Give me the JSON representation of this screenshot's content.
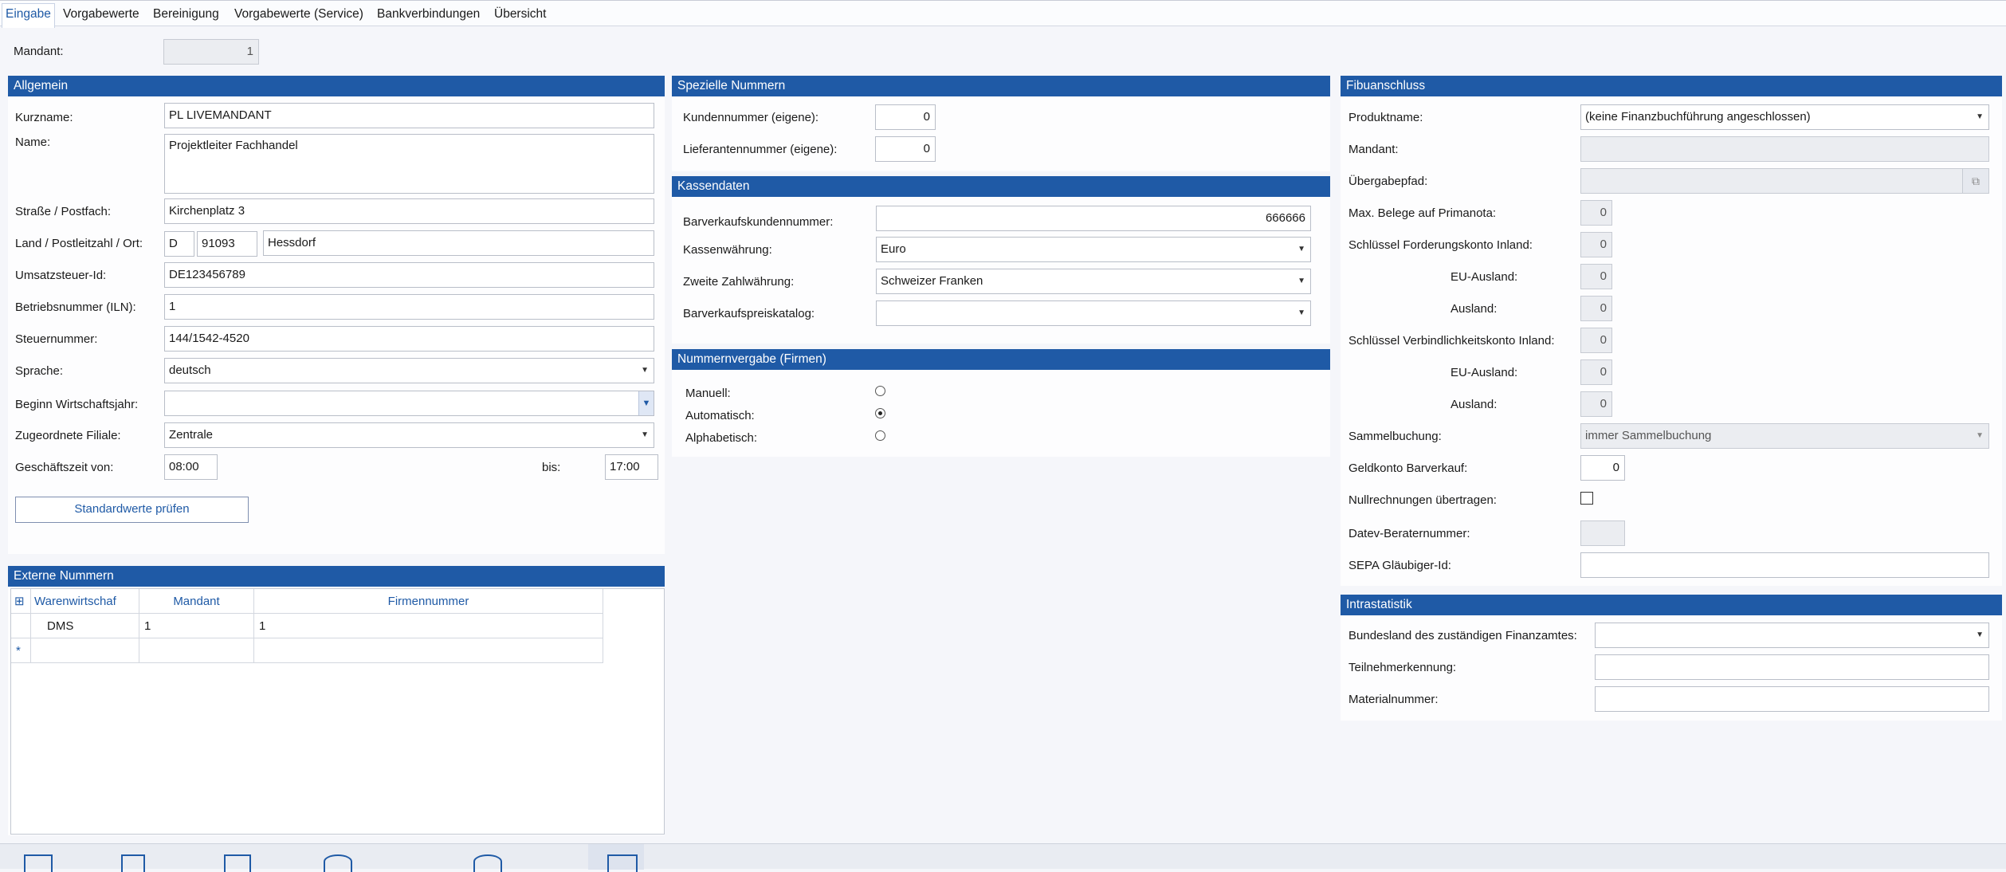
{
  "tabs": [
    "Eingabe",
    "Vorgabewerte",
    "Bereinigung",
    "Vorgabewerte (Service)",
    "Bankverbindungen",
    "Übersicht"
  ],
  "mandant": {
    "label": "Mandant:",
    "value": "1"
  },
  "allgemein": {
    "title": "Allgemein",
    "kurzname_label": "Kurzname:",
    "kurzname": "PL LIVEMANDANT",
    "name_label": "Name:",
    "name": "Projektleiter Fachhandel",
    "strasse_label": "Straße / Postfach:",
    "strasse": "Kirchenplatz 3",
    "land_label": "Land / Postleitzahl / Ort:",
    "land": "D",
    "plz": "91093",
    "ort": "Hessdorf",
    "ust_label": "Umsatzsteuer-Id:",
    "ust": "DE123456789",
    "iln_label": "Betriebsnummer (ILN):",
    "iln": "1",
    "steuer_label": "Steuernummer:",
    "steuer": "144/1542-4520",
    "sprache_label": "Sprache:",
    "sprache": "deutsch",
    "wj_label": "Beginn Wirtschaftsjahr:",
    "wj": "",
    "filiale_label": "Zugeordnete Filiale:",
    "filiale": "Zentrale",
    "zeit_label": "Geschäftszeit von:",
    "zeit_von": "08:00",
    "bis_label": "bis:",
    "zeit_bis": "17:00",
    "check_button": "Standardwerte prüfen"
  },
  "externe": {
    "title": "Externe Nummern",
    "columns": [
      "Warenwirtschaf",
      "Mandant",
      "Firmennummer"
    ],
    "rows": [
      [
        "DMS",
        "1",
        "1"
      ]
    ],
    "new_row_marker": "*"
  },
  "spezielle": {
    "title": "Spezielle Nummern",
    "kunden_label": "Kundennummer (eigene):",
    "kunden": "0",
    "lief_label": "Lieferantennummer (eigene):",
    "lief": "0"
  },
  "kasse": {
    "title": "Kassendaten",
    "bvk_label": "Barverkaufskundennummer:",
    "bvk": "666666",
    "waehr_label": "Kassenwährung:",
    "waehr": "Euro",
    "zweite_label": "Zweite Zahlwährung:",
    "zweite": "Schweizer Franken",
    "katalog_label": "Barverkaufspreiskatalog:",
    "katalog": ""
  },
  "nummern": {
    "title": "Nummernvergabe (Firmen)",
    "options": [
      "Manuell:",
      "Automatisch:",
      "Alphabetisch:"
    ],
    "selected": "Automatisch:"
  },
  "fibu": {
    "title": "Fibuanschluss",
    "produkt_label": "Produktname:",
    "produkt": "(keine Finanzbuchführung angeschlossen)",
    "mandant_label": "Mandant:",
    "mandant": "",
    "pfad_label": "Übergabepfad:",
    "pfad": "",
    "belege_label": "Max. Belege auf Primanota:",
    "belege": "0",
    "ford_label": "Schlüssel Forderungskonto Inland:",
    "ford": "0",
    "eu1_label": "EU-Ausland:",
    "eu1": "0",
    "aus1_label": "Ausland:",
    "aus1": "0",
    "verb_label": "Schlüssel Verbindlichkeitskonto Inland:",
    "verb": "0",
    "eu2_label": "EU-Ausland:",
    "eu2": "0",
    "aus2_label": "Ausland:",
    "aus2": "0",
    "sammel_label": "Sammelbuchung:",
    "sammel": "immer Sammelbuchung",
    "geld_label": "Geldkonto Barverkauf:",
    "geld": "0",
    "null_label": "Nullrechnungen übertragen:",
    "datev_label": "Datev-Beraternummer:",
    "datev": "",
    "sepa_label": "SEPA Gläubiger-Id:",
    "sepa": ""
  },
  "intra": {
    "title": "Intrastatistik",
    "bundesland_label": "Bundesland des zuständigen Finanzamtes:",
    "bundesland": "",
    "teiln_label": "Teilnehmerkennung:",
    "teiln": "",
    "material_label": "Materialnummer:",
    "material": ""
  },
  "toolbar_icons": [
    "window-icon",
    "door-icon",
    "save-icon",
    "database-icon",
    "database-icon",
    "building-icon"
  ]
}
